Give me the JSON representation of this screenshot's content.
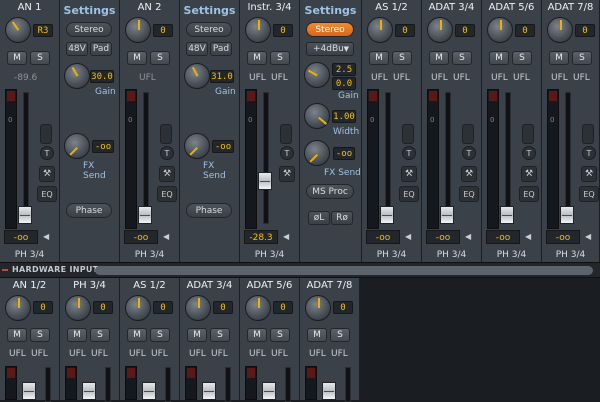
{
  "top_strips": [
    {
      "name": "AN 1",
      "knob_value": "R3",
      "readout": "-89.6",
      "fader_value": "-oo",
      "io": "PH 3/4",
      "has_insert": true
    },
    {
      "name": "AN 2",
      "knob_value": "0",
      "readout": "UFL",
      "fader_value": "-oo",
      "io": "PH 3/4",
      "has_insert": true
    },
    {
      "name": "Instr. 3/4",
      "knob_value": "0",
      "readout": "UFL",
      "fader_value": "-28.3",
      "io": "PH 3/4",
      "has_insert": true
    },
    {
      "name": "AS 1/2",
      "knob_value": "0",
      "readout": "UFL",
      "fader_value": "-oo",
      "io": "PH 3/4",
      "has_insert": true
    },
    {
      "name": "ADAT 3/4",
      "knob_value": "0",
      "readout": "UFL",
      "fader_value": "-oo",
      "io": "PH 3/4",
      "has_insert": true
    },
    {
      "name": "ADAT 5/6",
      "knob_value": "0",
      "readout": "UFL",
      "fader_value": "-oo",
      "io": "PH 3/4",
      "has_insert": true
    },
    {
      "name": "ADAT 7/8",
      "knob_value": "0",
      "readout": "UFL",
      "fader_value": "-oo",
      "io": "PH 3/4",
      "has_insert": true
    }
  ],
  "settings_panels": [
    {
      "title": "Settings",
      "stereo": "Stereo",
      "p48": "48V",
      "pad": "Pad",
      "gain": "30.0",
      "gain_label": "Gain",
      "fx": "-oo",
      "fx_label": "FX Send",
      "phase": "Phase"
    },
    {
      "title": "Settings",
      "stereo": "Stereo",
      "p48": "48V",
      "pad": "Pad",
      "gain": "31.0",
      "gain_label": "Gain",
      "fx": "-oo",
      "fx_label": "FX Send",
      "phase": "Phase"
    }
  ],
  "settings_instr": {
    "title": "Settings",
    "stereo": "Stereo",
    "level": "+4dBu",
    "gain1": "2.5",
    "gain2": "0.0",
    "gain_label": "Gain",
    "width": "1.00",
    "width_label": "Width",
    "fx": "-oo",
    "fx_label": "FX Send",
    "msproc": "MS Proc",
    "phase_l": "øL",
    "phase_r": "Rø"
  },
  "section": {
    "title": "HARDWARE INPUTS"
  },
  "bottom_strips": [
    {
      "name": "AN 1/2",
      "knob_value": "0",
      "ufl1": "UFL",
      "ufl2": "UFL"
    },
    {
      "name": "PH 3/4",
      "knob_value": "0",
      "ufl1": "UFL",
      "ufl2": "UFL"
    },
    {
      "name": "AS 1/2",
      "knob_value": "0",
      "ufl1": "UFL",
      "ufl2": "UFL"
    },
    {
      "name": "ADAT 3/4",
      "knob_value": "0",
      "ufl1": "UFL",
      "ufl2": "UFL"
    },
    {
      "name": "ADAT 5/6",
      "knob_value": "0",
      "ufl1": "UFL",
      "ufl2": "UFL"
    },
    {
      "name": "ADAT 7/8",
      "knob_value": "0",
      "ufl1": "UFL",
      "ufl2": "UFL"
    }
  ],
  "labels": {
    "mute": "M",
    "solo": "S",
    "talkback": "T",
    "eq": "EQ",
    "meter_zero": "0",
    "wrench": "⚒"
  }
}
